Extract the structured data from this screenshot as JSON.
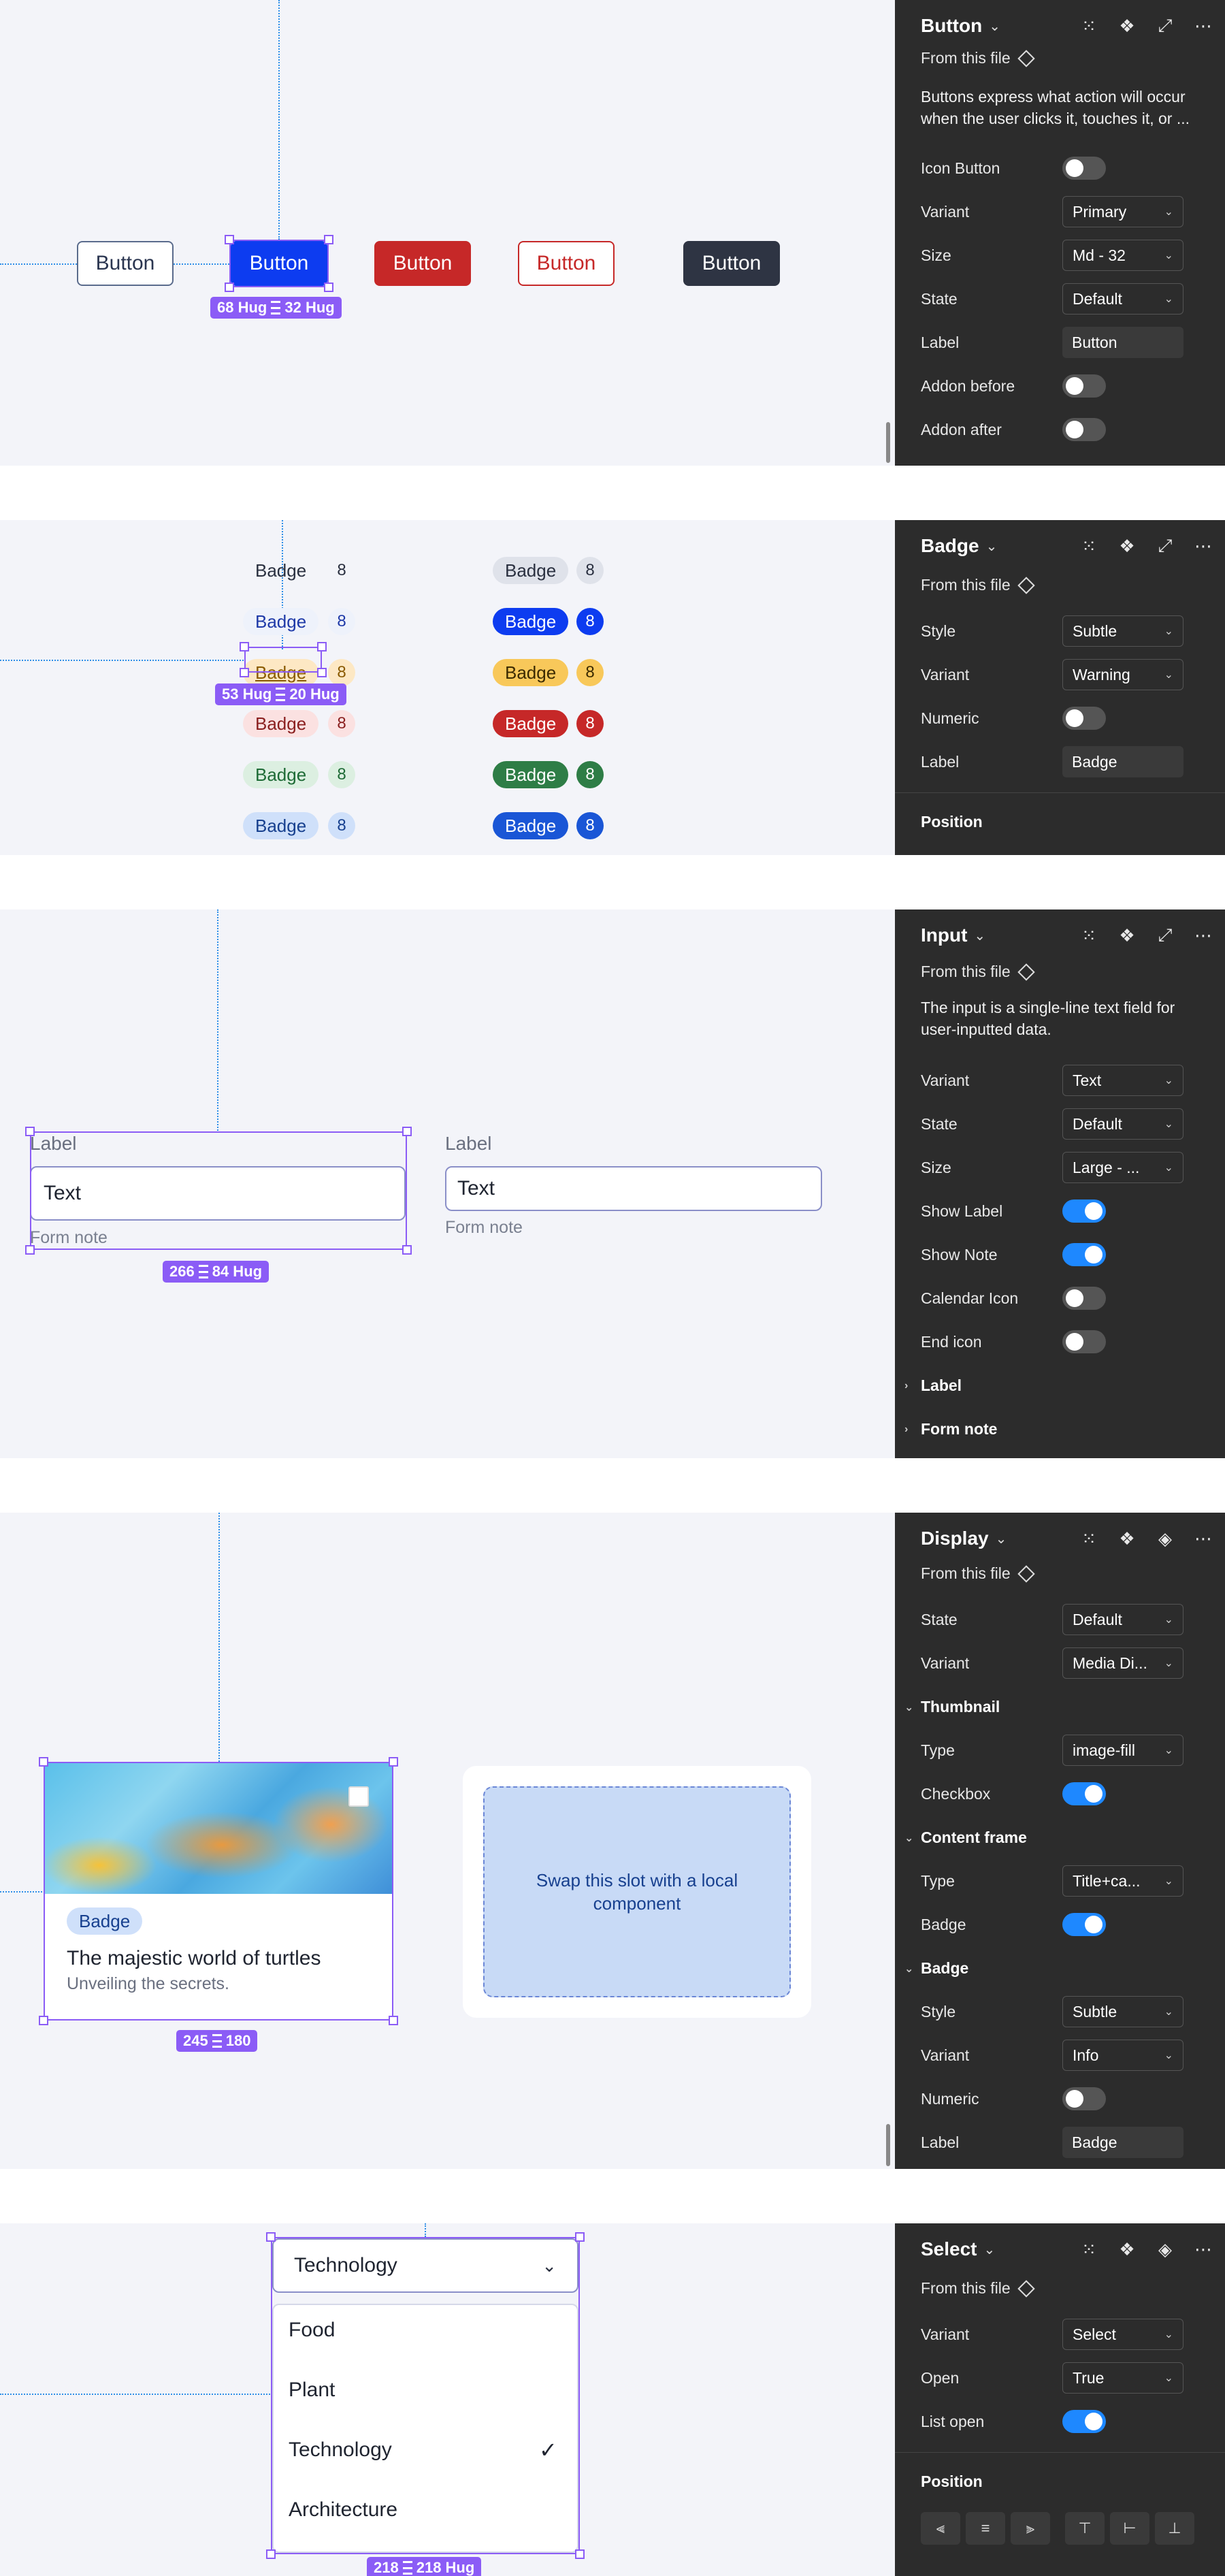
{
  "button_section": {
    "buttons": [
      {
        "label": "Button",
        "style": "outline"
      },
      {
        "label": "Button",
        "style": "primary"
      },
      {
        "label": "Button",
        "style": "danger"
      },
      {
        "label": "Button",
        "style": "danger-outline"
      },
      {
        "label": "Button",
        "style": "dark"
      }
    ],
    "dimension": "68 Hug",
    "dimension2": "32 Hug",
    "panel": {
      "title": "Button",
      "from": "From this file",
      "description": "Buttons express what action will occur when the user clicks it, touches it, or ...",
      "rows": [
        {
          "label": "Icon Button"
        },
        {
          "label": "Variant",
          "value": "Primary"
        },
        {
          "label": "Size",
          "value": "Md - 32"
        },
        {
          "label": "State",
          "value": "Default"
        },
        {
          "label": "Label",
          "value": "Button"
        },
        {
          "label": "Addon before"
        },
        {
          "label": "Addon after"
        }
      ]
    }
  },
  "badge_section": {
    "subtle_badges": [
      {
        "label": "Badge",
        "num": "8"
      },
      {
        "label": "Badge",
        "num": "8"
      },
      {
        "label": "Badge",
        "num": "8"
      },
      {
        "label": "Badge",
        "num": "8"
      },
      {
        "label": "Badge",
        "num": "8"
      },
      {
        "label": "Badge",
        "num": "8"
      }
    ],
    "bold_badges": [
      {
        "label": "Badge",
        "num": "8"
      },
      {
        "label": "Badge",
        "num": "8"
      },
      {
        "label": "Badge",
        "num": "8"
      },
      {
        "label": "Badge",
        "num": "8"
      },
      {
        "label": "Badge",
        "num": "8"
      },
      {
        "label": "Badge",
        "num": "8"
      }
    ],
    "dimension": "53 Hug",
    "dimension2": "20 Hug",
    "panel": {
      "title": "Badge",
      "from": "From this file",
      "rows": [
        {
          "label": "Style",
          "value": "Subtle"
        },
        {
          "label": "Variant",
          "value": "Warning"
        },
        {
          "label": "Numeric"
        },
        {
          "label": "Label",
          "value": "Badge"
        }
      ],
      "position": "Position"
    }
  },
  "input_section": {
    "inputs": [
      {
        "label": "Label",
        "value": "Text",
        "note": "Form note"
      },
      {
        "label": "Label",
        "value": "Text",
        "note": "Form note"
      }
    ],
    "dimension": "266",
    "dimension2": "84 Hug",
    "panel": {
      "title": "Input",
      "from": "From this file",
      "description": "The input is a single-line text field for user-inputted data.",
      "rows": [
        {
          "label": "Variant",
          "value": "Text"
        },
        {
          "label": "State",
          "value": "Default"
        },
        {
          "label": "Size",
          "value": "Large - ..."
        },
        {
          "label": "Show Label"
        },
        {
          "label": "Show Note"
        },
        {
          "label": "Calendar Icon"
        },
        {
          "label": "End icon"
        }
      ],
      "sections": [
        "Label",
        "Form note"
      ]
    }
  },
  "display_section": {
    "card": {
      "badge": "Badge",
      "title": "The majestic world of turtles",
      "subtitle": "Unveiling the secrets."
    },
    "slot_text": "Swap this slot with a local component",
    "dimension": "245",
    "dimension2": "180",
    "panel": {
      "title": "Display",
      "from": "From this file",
      "rows1": [
        {
          "label": "State",
          "value": "Default"
        },
        {
          "label": "Variant",
          "value": "Media Di..."
        }
      ],
      "thumbnail": "Thumbnail",
      "rows2": [
        {
          "label": "Type",
          "value": "image-fill"
        },
        {
          "label": "Checkbox"
        }
      ],
      "content_frame": "Content frame",
      "rows3": [
        {
          "label": "Type",
          "value": "Title+ca..."
        },
        {
          "label": "Badge"
        }
      ],
      "badge_sec": "Badge",
      "rows4": [
        {
          "label": "Style",
          "value": "Subtle"
        },
        {
          "label": "Variant",
          "value": "Info"
        },
        {
          "label": "Numeric"
        },
        {
          "label": "Label",
          "value": "Badge"
        }
      ]
    }
  },
  "select_section": {
    "selected": "Technology",
    "options": [
      "Food",
      "Plant",
      "Technology",
      "Architecture"
    ],
    "dimension": "218",
    "dimension2": "218 Hug",
    "panel": {
      "title": "Select",
      "from": "From this file",
      "rows": [
        {
          "label": "Variant",
          "value": "Select"
        },
        {
          "label": "Open",
          "value": "True"
        },
        {
          "label": "List open"
        }
      ],
      "position": "Position"
    }
  }
}
